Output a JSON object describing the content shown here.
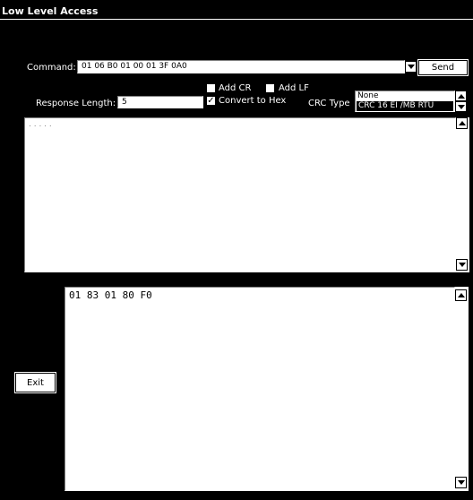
{
  "window": {
    "title": "Low Level Access"
  },
  "command": {
    "label": "Command:",
    "value": "01 06 B0 01 00 01 3F 0A0",
    "send_label": "Send"
  },
  "options": {
    "add_cr_label": "Add CR",
    "add_cr_checked": false,
    "add_lf_label": "Add LF",
    "add_lf_checked": false,
    "convert_hex_label": "Convert to Hex",
    "convert_hex_checked": true,
    "response_length_label": "Response Length:",
    "response_length_value": "5",
    "crc_label": "CRC Type",
    "crc_options": [
      "None",
      "CRC 16 EI /MB RTU"
    ],
    "crc_selected": "CRC 16 EI /MB RTU"
  },
  "log_pane": {
    "text": ". . . . ."
  },
  "response_pane": {
    "text": "01 83 01 80 F0"
  },
  "exit_label": "Exit"
}
